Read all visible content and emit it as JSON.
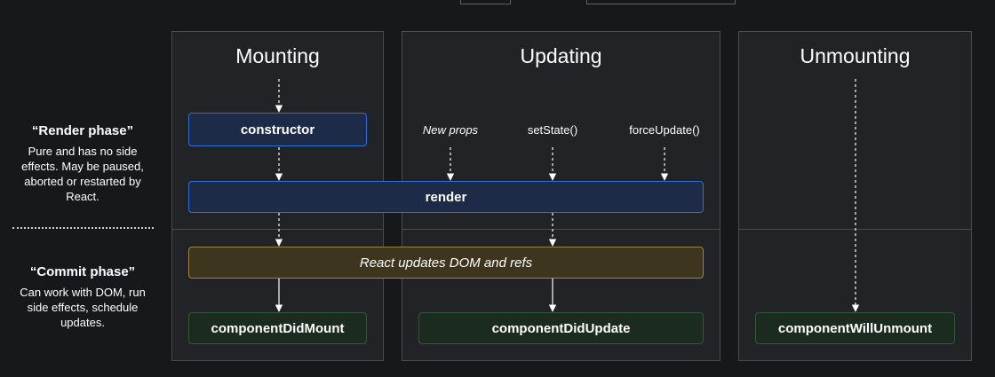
{
  "columns": {
    "mounting": "Mounting",
    "updating": "Updating",
    "unmounting": "Unmounting"
  },
  "phases": {
    "render": {
      "title": "“Render phase”",
      "description": "Pure and has no side effects. May be paused, aborted or restarted by React."
    },
    "commit": {
      "title": "“Commit phase”",
      "description": "Can work with DOM, run side effects, schedule updates."
    }
  },
  "boxes": {
    "constructor": "constructor",
    "render": "render",
    "react_updates": "React updates DOM and refs",
    "did_mount": "componentDidMount",
    "did_update": "componentDidUpdate",
    "will_unmount": "componentWillUnmount"
  },
  "triggers": {
    "new_props": "New props",
    "set_state": "setState()",
    "force_update": "forceUpdate()"
  },
  "colors": {
    "background": "#17181c",
    "column": "#222327",
    "render_phase_border": "#2f6fd6",
    "dom_update_border": "#9b8444",
    "commit_border": "#34573a"
  }
}
